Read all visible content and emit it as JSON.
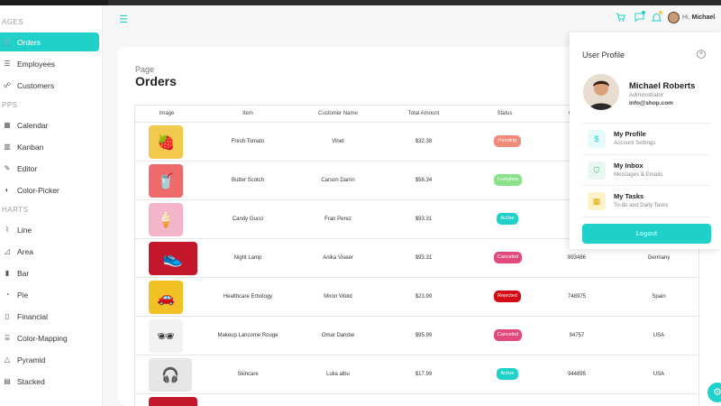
{
  "sidebar": {
    "sections": [
      "AGES",
      "PPS",
      "HARTS"
    ],
    "items": [
      {
        "label": "Orders",
        "icon": "cart-icon",
        "glyph": "🛒"
      },
      {
        "label": "Employees",
        "icon": "employees-icon",
        "glyph": "☰"
      },
      {
        "label": "Customers",
        "icon": "customers-icon",
        "glyph": "☍"
      },
      {
        "label": "Calendar",
        "icon": "calendar-icon",
        "glyph": "▦"
      },
      {
        "label": "Kanban",
        "icon": "kanban-icon",
        "glyph": "▥"
      },
      {
        "label": "Editor",
        "icon": "editor-icon",
        "glyph": "✎"
      },
      {
        "label": "Color-Picker",
        "icon": "color-picker-icon",
        "glyph": "◐"
      },
      {
        "label": "Line",
        "icon": "line-chart-icon",
        "glyph": "⌇"
      },
      {
        "label": "Area",
        "icon": "area-chart-icon",
        "glyph": "◿"
      },
      {
        "label": "Bar",
        "icon": "bar-chart-icon",
        "glyph": "▮"
      },
      {
        "label": "Pie",
        "icon": "pie-chart-icon",
        "glyph": "◔"
      },
      {
        "label": "Financial",
        "icon": "financial-icon",
        "glyph": "▯"
      },
      {
        "label": "Color-Mapping",
        "icon": "color-mapping-icon",
        "glyph": "⌸"
      },
      {
        "label": "Pyramid",
        "icon": "pyramid-icon",
        "glyph": "△"
      },
      {
        "label": "Stacked",
        "icon": "stacked-icon",
        "glyph": "▤"
      }
    ]
  },
  "topbar": {
    "menu_glyph": "☰",
    "greeting": "Hi,",
    "user": "Michael",
    "caret": "⌄"
  },
  "page": {
    "breadcrumb": "Page",
    "title": "Orders"
  },
  "table": {
    "headers": [
      "Image",
      "Item",
      "Customer Name",
      "Total Amount",
      "Status",
      "C"
    ],
    "rows": [
      {
        "item": "Fresh Tomato",
        "customer": "Vinet",
        "amount": "$32.38",
        "status": "Pending",
        "status_color": "#f08a79",
        "id": "",
        "location": "",
        "thumb_color": "#f2c94c",
        "product": "🍓"
      },
      {
        "item": "Butter Scotch",
        "customer": "Carson Darrin",
        "amount": "$56.34",
        "status": "Complete",
        "status_color": "#8be08a",
        "id": "",
        "location": "",
        "thumb_color": "#ee6b6b",
        "product": "🥤"
      },
      {
        "item": "Candy Gucci",
        "customer": "Fran Perez",
        "amount": "$93.31",
        "status": "Active",
        "status_color": "#1fd1c9",
        "id": "",
        "location": "",
        "thumb_color": "#f3b6c8",
        "product": "🍦"
      },
      {
        "item": "Night Lamp",
        "customer": "Anika Viseer",
        "amount": "$93.31",
        "status": "Canceled",
        "status_color": "#e2497f",
        "id": "893486",
        "location": "Germany",
        "thumb_color": "#c4172c",
        "product": "👟"
      },
      {
        "item": "Healthcare Erbology",
        "customer": "Miron Vitold",
        "amount": "$23.99",
        "status": "Rejected",
        "status_color": "#d40a14",
        "id": "748975",
        "location": "Spain",
        "thumb_color": "#f2c126",
        "product": "🚗"
      },
      {
        "item": "Makeup Lancome Rouge",
        "customer": "Omar Darobe",
        "amount": "$95.99",
        "status": "Canceled",
        "status_color": "#e2497f",
        "id": "94757",
        "location": "USA",
        "thumb_color": "#f2f2f2",
        "product": "🕶"
      },
      {
        "item": "Skincare",
        "customer": "Lulia albu",
        "amount": "$17.99",
        "status": "Active",
        "status_color": "#1fd1c9",
        "id": "944895",
        "location": "USA",
        "thumb_color": "#e6e6e6",
        "product": "🎧"
      }
    ]
  },
  "profile": {
    "title": "User Profile",
    "name": "Michael Roberts",
    "role": "Administrator",
    "email": "info@shop.com",
    "items": [
      {
        "title": "My Profile",
        "subtitle": "Account Settings",
        "glyph": "$",
        "icon": "dollar-icon",
        "bg": "#e6fbf9",
        "fg": "#1fd1c9"
      },
      {
        "title": "My Inbox",
        "subtitle": "Messages & Emails",
        "glyph": "⛉",
        "icon": "shield-icon",
        "bg": "#e8f8f0",
        "fg": "#3bbf7a"
      },
      {
        "title": "My Tasks",
        "subtitle": "To-do and Daily Tasks",
        "glyph": "▦",
        "icon": "tasks-icon",
        "bg": "#fdf3c8",
        "fg": "#e0a800"
      }
    ],
    "logout_label": "Logout"
  }
}
